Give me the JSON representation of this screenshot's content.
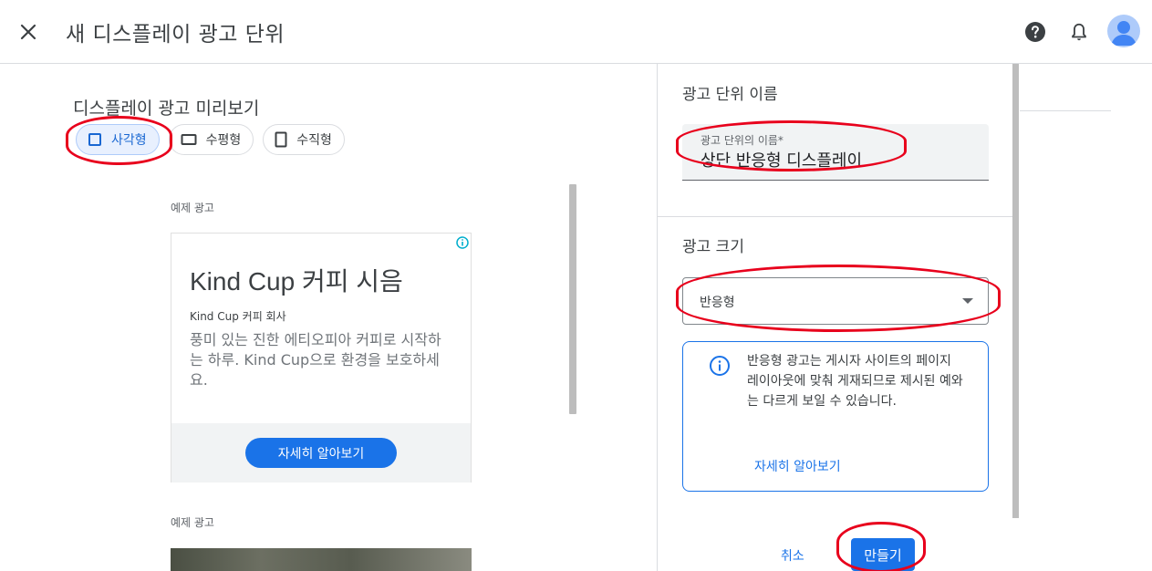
{
  "header": {
    "title": "새 디스플레이 광고 단위"
  },
  "preview": {
    "title": "디스플레이 광고 미리보기",
    "chips": [
      {
        "label": "사각형",
        "selected": true
      },
      {
        "label": "수평형",
        "selected": false
      },
      {
        "label": "수직형",
        "selected": false
      }
    ],
    "sample_label": "예제 광고",
    "ad": {
      "headline": "Kind Cup 커피 시음",
      "company": "Kind Cup 커피 회사",
      "description": "풍미 있는 진한 에티오피아 커피로 시작하는 하루. Kind Cup으로 환경을 보호하세요.",
      "cta": "자세히 알아보기"
    },
    "sample_label_2": "예제 광고"
  },
  "panel": {
    "name_section_title": "광고 단위 이름",
    "name_field_label": "광고 단위의 이름*",
    "name_field_value": "상단 반응형 디스플레이",
    "size_section_title": "광고 크기",
    "size_select_value": "반응형",
    "info_text": "반응형 광고는 게시자 사이트의 페이지 레이아웃에 맞춰 게재되므로 제시된 예와는 다르게 보일 수 있습니다.",
    "info_link": "자세히 알아보기",
    "cancel_label": "취소",
    "create_label": "만들기"
  },
  "icons": [
    "close-icon",
    "help-icon",
    "bell-icon",
    "avatar",
    "square-icon",
    "horizontal-rect-icon",
    "vertical-rect-icon",
    "info-icon",
    "chevron-down-icon"
  ],
  "colors": {
    "accent": "#1a73e8",
    "selected_chip_bg": "#e8f0fe",
    "annotation_red": "#e8001c"
  }
}
